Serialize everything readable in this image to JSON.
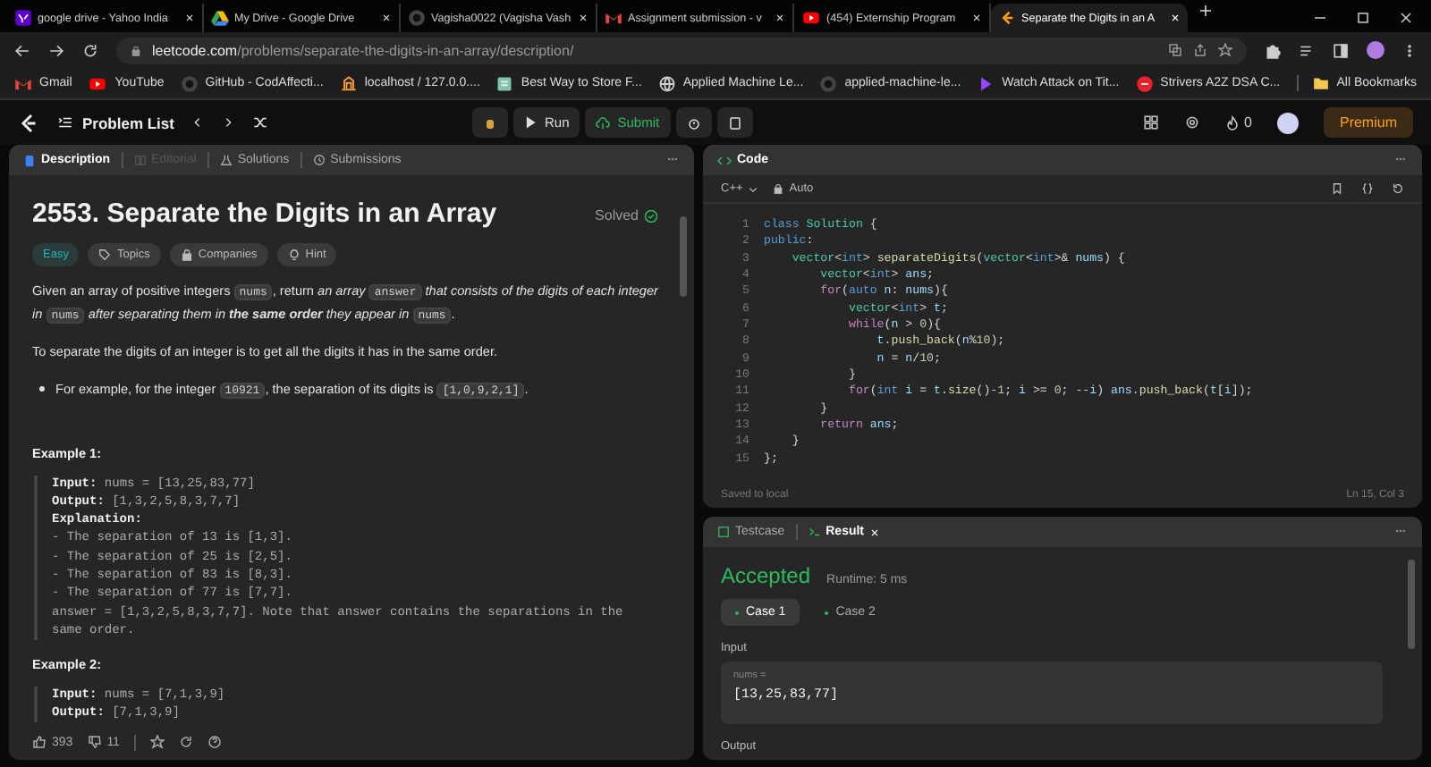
{
  "browser": {
    "tabs": [
      {
        "title": "google drive - Yahoo India",
        "kind": "yahoo",
        "selected": false
      },
      {
        "title": "My Drive - Google Drive",
        "kind": "drive",
        "selected": false
      },
      {
        "title": "Vagisha0022 (Vagisha Vash",
        "kind": "github",
        "selected": false
      },
      {
        "title": "Assignment submission - v",
        "kind": "gmail",
        "selected": false
      },
      {
        "title": "(454) Externship Program",
        "kind": "youtube",
        "selected": false
      },
      {
        "title": "Separate the Digits in an A",
        "kind": "leetcode",
        "selected": true
      }
    ],
    "address": {
      "host": "leetcode.com",
      "path": "/problems/separate-the-digits-in-an-array/description/"
    },
    "bookmarks": [
      {
        "label": "Gmail",
        "kind": "gmail"
      },
      {
        "label": "YouTube",
        "kind": "youtube"
      },
      {
        "label": "GitHub - CodAffecti...",
        "kind": "github"
      },
      {
        "label": "localhost / 127.0.0....",
        "kind": "server"
      },
      {
        "label": "Best Way to Store F...",
        "kind": "page"
      },
      {
        "label": "Applied Machine Le...",
        "kind": "globe"
      },
      {
        "label": "applied-machine-le...",
        "kind": "github"
      },
      {
        "label": "Watch Attack on Tit...",
        "kind": "play"
      },
      {
        "label": "Strivers A2Z DSA C...",
        "kind": "striver"
      }
    ],
    "all_bookmarks": "All Bookmarks"
  },
  "nav": {
    "problem_list": "Problem List",
    "run": "Run",
    "submit": "Submit",
    "streak": "0",
    "premium": "Premium"
  },
  "description": {
    "tabs": [
      {
        "label": "Description",
        "selected": true,
        "disabled": false
      },
      {
        "label": "Editorial",
        "selected": false,
        "disabled": true
      },
      {
        "label": "Solutions",
        "selected": false,
        "disabled": false
      },
      {
        "label": "Submissions",
        "selected": false,
        "disabled": false
      }
    ],
    "title": "2553. Separate the Digits in an Array",
    "status": "Solved",
    "tags": [
      {
        "label": "Easy",
        "kind": "difficulty"
      },
      {
        "label": "Topics",
        "kind": "topics"
      },
      {
        "label": "Companies",
        "kind": "companies"
      },
      {
        "label": "Hint",
        "kind": "hint"
      }
    ],
    "paragraphs": [
      {
        "kind": "text",
        "segments": [
          {
            "text": "Given an array of positive integers ",
            "kind": "plain"
          },
          {
            "text": "nums",
            "kind": "code"
          },
          {
            "text": ", return ",
            "kind": "plain"
          },
          {
            "text": "an array ",
            "kind": "italic"
          },
          {
            "text": "answer",
            "kind": "code"
          },
          {
            "text": " that consists of the digits of each integer in ",
            "kind": "italic"
          },
          {
            "text": "nums",
            "kind": "code"
          },
          {
            "text": " after separating them in ",
            "kind": "italic"
          },
          {
            "text": "the same order",
            "kind": "emphasis"
          },
          {
            "text": " they appear in ",
            "kind": "italic"
          },
          {
            "text": "nums",
            "kind": "code"
          },
          {
            "text": ".",
            "kind": "plain"
          }
        ]
      },
      {
        "kind": "text",
        "segments": [
          {
            "text": "To separate the digits of an integer is to get all the digits it has in the same order.",
            "kind": "plain"
          }
        ]
      },
      {
        "kind": "bullet",
        "segments": [
          {
            "text": "For example, for the integer ",
            "kind": "plain"
          },
          {
            "text": "10921",
            "kind": "code"
          },
          {
            "text": ", the separation of its digits is ",
            "kind": "plain"
          },
          {
            "text": "[1,0,9,2,1]",
            "kind": "code"
          },
          {
            "text": ".",
            "kind": "plain"
          }
        ]
      }
    ],
    "examples": [
      {
        "title": "Example 1:",
        "lines": [
          {
            "label": "Input:",
            "text": "nums = [13,25,83,77]"
          },
          {
            "label": "Output:",
            "text": "[1,3,2,5,8,3,7,7]"
          },
          {
            "label": "Explanation:"
          },
          {
            "text": "- The separation of 13 is [1,3]."
          },
          {
            "text": "- The separation of 25 is [2,5]."
          },
          {
            "text": "- The separation of 83 is [8,3]."
          },
          {
            "text": "- The separation of 77 is [7,7]."
          },
          {
            "text": "answer = [1,3,2,5,8,3,7,7]. Note that answer contains the separations in the same order."
          }
        ]
      },
      {
        "title": "Example 2:",
        "lines": [
          {
            "label": "Input:",
            "text": "nums = [7,1,3,9]"
          },
          {
            "label": "Output:",
            "text": "[7,1,3,9]"
          }
        ]
      }
    ],
    "likes": "393",
    "dislikes": "11"
  },
  "code": {
    "title": "Code",
    "language": "C++",
    "mode": "Auto",
    "lines": [
      {
        "n": "1",
        "tokens": [
          {
            "text": "class",
            "kind": "keyword"
          },
          {
            "text": " Solution",
            "kind": "type"
          },
          {
            "text": " {",
            "kind": "plain"
          }
        ]
      },
      {
        "n": "2",
        "tokens": [
          {
            "text": "public",
            "kind": "keyword"
          },
          {
            "text": ":",
            "kind": "plain"
          }
        ]
      },
      {
        "n": "3",
        "tokens": [
          {
            "text": "    vector",
            "kind": "type"
          },
          {
            "text": "<",
            "kind": "plain"
          },
          {
            "text": "int",
            "kind": "keyword"
          },
          {
            "text": "> ",
            "kind": "plain"
          },
          {
            "text": "separateDigits",
            "kind": "function"
          },
          {
            "text": "(",
            "kind": "plain"
          },
          {
            "text": "vector",
            "kind": "type"
          },
          {
            "text": "<",
            "kind": "plain"
          },
          {
            "text": "int",
            "kind": "keyword"
          },
          {
            "text": ">& ",
            "kind": "plain"
          },
          {
            "text": "nums",
            "kind": "variable"
          },
          {
            "text": ") {",
            "kind": "plain"
          }
        ]
      },
      {
        "n": "4",
        "tokens": [
          {
            "text": "        vector",
            "kind": "type"
          },
          {
            "text": "<",
            "kind": "plain"
          },
          {
            "text": "int",
            "kind": "keyword"
          },
          {
            "text": "> ",
            "kind": "plain"
          },
          {
            "text": "ans",
            "kind": "variable"
          },
          {
            "text": ";",
            "kind": "plain"
          }
        ]
      },
      {
        "n": "5",
        "tokens": [
          {
            "text": "        for",
            "kind": "control"
          },
          {
            "text": "(",
            "kind": "plain"
          },
          {
            "text": "auto",
            "kind": "keyword"
          },
          {
            "text": " n",
            "kind": "variable"
          },
          {
            "text": ": ",
            "kind": "plain"
          },
          {
            "text": "nums",
            "kind": "variable"
          },
          {
            "text": "){",
            "kind": "plain"
          }
        ]
      },
      {
        "n": "6",
        "tokens": [
          {
            "text": "            vector",
            "kind": "type"
          },
          {
            "text": "<",
            "kind": "plain"
          },
          {
            "text": "int",
            "kind": "keyword"
          },
          {
            "text": "> ",
            "kind": "plain"
          },
          {
            "text": "t",
            "kind": "variable"
          },
          {
            "text": ";",
            "kind": "plain"
          }
        ]
      },
      {
        "n": "7",
        "tokens": [
          {
            "text": "            while",
            "kind": "control"
          },
          {
            "text": "(",
            "kind": "plain"
          },
          {
            "text": "n",
            "kind": "variable"
          },
          {
            "text": " > ",
            "kind": "plain"
          },
          {
            "text": "0",
            "kind": "number"
          },
          {
            "text": "){",
            "kind": "plain"
          }
        ]
      },
      {
        "n": "8",
        "tokens": [
          {
            "text": "                t",
            "kind": "variable"
          },
          {
            "text": ".",
            "kind": "plain"
          },
          {
            "text": "push_back",
            "kind": "function"
          },
          {
            "text": "(",
            "kind": "plain"
          },
          {
            "text": "n",
            "kind": "variable"
          },
          {
            "text": "%",
            "kind": "plain"
          },
          {
            "text": "10",
            "kind": "number"
          },
          {
            "text": ");",
            "kind": "plain"
          }
        ]
      },
      {
        "n": "9",
        "tokens": [
          {
            "text": "                n",
            "kind": "variable"
          },
          {
            "text": " = ",
            "kind": "plain"
          },
          {
            "text": "n",
            "kind": "variable"
          },
          {
            "text": "/",
            "kind": "plain"
          },
          {
            "text": "10",
            "kind": "number"
          },
          {
            "text": ";",
            "kind": "plain"
          }
        ]
      },
      {
        "n": "10",
        "tokens": [
          {
            "text": "            }",
            "kind": "plain"
          }
        ]
      },
      {
        "n": "11",
        "tokens": [
          {
            "text": "            for",
            "kind": "control"
          },
          {
            "text": "(",
            "kind": "plain"
          },
          {
            "text": "int",
            "kind": "keyword"
          },
          {
            "text": " i",
            "kind": "variable"
          },
          {
            "text": " = ",
            "kind": "plain"
          },
          {
            "text": "t",
            "kind": "variable"
          },
          {
            "text": ".",
            "kind": "plain"
          },
          {
            "text": "size",
            "kind": "function"
          },
          {
            "text": "()-",
            "kind": "plain"
          },
          {
            "text": "1",
            "kind": "number"
          },
          {
            "text": "; ",
            "kind": "plain"
          },
          {
            "text": "i",
            "kind": "variable"
          },
          {
            "text": " >= ",
            "kind": "plain"
          },
          {
            "text": "0",
            "kind": "number"
          },
          {
            "text": "; --",
            "kind": "plain"
          },
          {
            "text": "i",
            "kind": "variable"
          },
          {
            "text": ") ",
            "kind": "plain"
          },
          {
            "text": "ans",
            "kind": "variable"
          },
          {
            "text": ".",
            "kind": "plain"
          },
          {
            "text": "push_back",
            "kind": "function"
          },
          {
            "text": "(",
            "kind": "plain"
          },
          {
            "text": "t",
            "kind": "variable"
          },
          {
            "text": "[",
            "kind": "plain"
          },
          {
            "text": "i",
            "kind": "variable"
          },
          {
            "text": "]);",
            "kind": "plain"
          }
        ]
      },
      {
        "n": "12",
        "tokens": [
          {
            "text": "        }",
            "kind": "plain"
          }
        ]
      },
      {
        "n": "13",
        "tokens": [
          {
            "text": "        return",
            "kind": "control"
          },
          {
            "text": " ans",
            "kind": "variable"
          },
          {
            "text": ";",
            "kind": "plain"
          }
        ]
      },
      {
        "n": "14",
        "tokens": [
          {
            "text": "    }",
            "kind": "plain"
          }
        ]
      },
      {
        "n": "15",
        "tokens": [
          {
            "text": "};",
            "kind": "plain"
          }
        ]
      }
    ],
    "saved": "Saved to local",
    "cursor": "Ln 15, Col 3"
  },
  "result": {
    "tabs": [
      {
        "label": "Testcase",
        "selected": false,
        "kind": "testcase"
      },
      {
        "label": "Result",
        "selected": true,
        "kind": "result"
      }
    ],
    "verdict": "Accepted",
    "runtime": "Runtime: 5 ms",
    "cases": [
      {
        "label": "Case 1",
        "selected": true
      },
      {
        "label": "Case 2",
        "selected": false
      }
    ],
    "input_label": "Input",
    "input_name": "nums =",
    "input_value": "[13,25,83,77]",
    "output_label": "Output"
  }
}
